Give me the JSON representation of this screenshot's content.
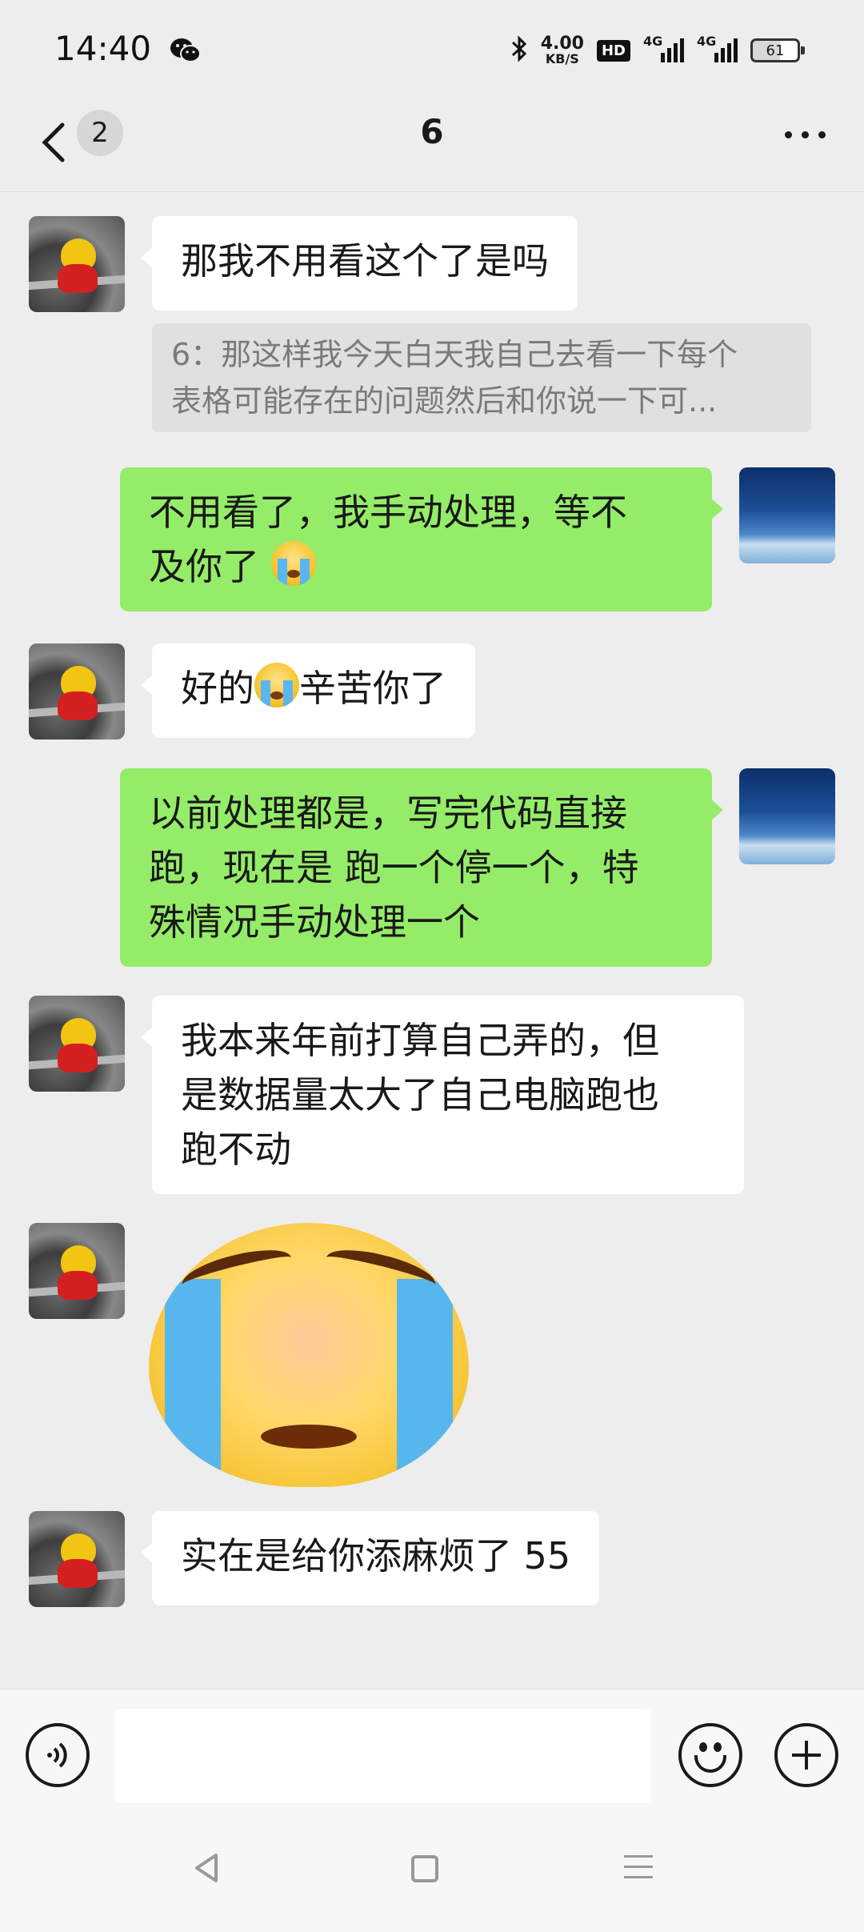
{
  "status_bar": {
    "time": "14:40",
    "net_speed": "4.00",
    "net_unit": "KB/S",
    "hd_label": "HD",
    "signal_1_label": "4G",
    "signal_2_label": "4G",
    "battery_level": "61",
    "icons": [
      "wechat-icon",
      "bluetooth-icon",
      "signal-icon",
      "battery-icon"
    ]
  },
  "header": {
    "unread_count": "2",
    "title": "6"
  },
  "messages": [
    {
      "sender": "friend",
      "type": "text",
      "text": "那我不用看这个了是吗"
    },
    {
      "sender": "friend",
      "type": "quote",
      "lines": [
        "6：那这样我今天白天我自己去看一下每个",
        "表格可能存在的问题然后和你说一下可..."
      ]
    },
    {
      "sender": "me",
      "type": "text",
      "line1": "不用看了，我手动处理，等不",
      "line2": "及你了"
    },
    {
      "sender": "friend",
      "type": "text",
      "before": "好的",
      "after": "辛苦你了"
    },
    {
      "sender": "me",
      "type": "text",
      "lines": [
        "以前处理都是，写完代码直接",
        "跑，现在是 跑一个停一个，特",
        "殊情况手动处理一个"
      ]
    },
    {
      "sender": "friend",
      "type": "text",
      "lines": [
        "我本来年前打算自己弄的，但",
        "是数据量太大了自己电脑跑也",
        "跑不动"
      ]
    },
    {
      "sender": "friend",
      "type": "sticker",
      "icon": "crying-face-sticker"
    },
    {
      "sender": "friend",
      "type": "text",
      "text": "实在是给你添麻烦了 55"
    }
  ],
  "input_bar": {
    "placeholder": "",
    "icons": [
      "voice-icon",
      "emoji-icon",
      "plus-icon"
    ]
  },
  "colors": {
    "background": "#ededed",
    "outgoing_bubble": "#95ec69",
    "incoming_bubble": "#ffffff",
    "quote_bg": "#e0e0e0"
  }
}
